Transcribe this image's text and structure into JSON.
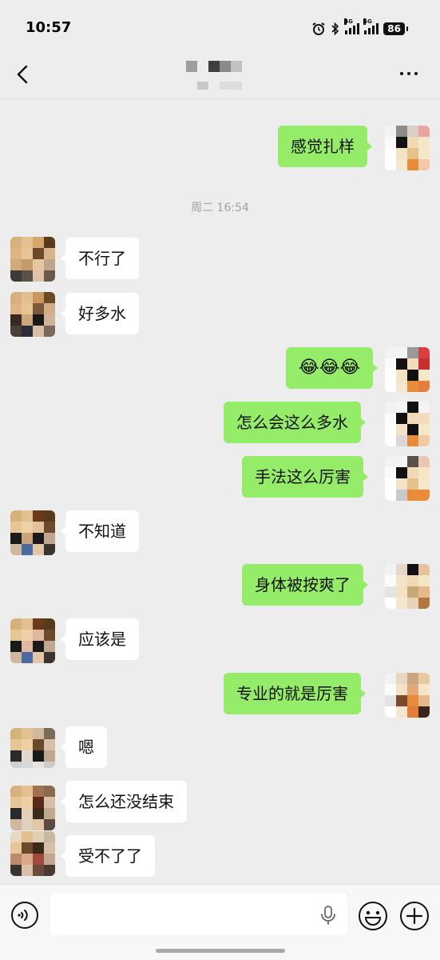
{
  "status_bar": {
    "time": "10:57",
    "net1": "4G",
    "net2": "5G",
    "battery": "86"
  },
  "header": {
    "back_icon": "chevron-left-icon",
    "more_icon": "ellipsis-icon"
  },
  "chat": {
    "messages": [
      {
        "side": "right",
        "text": "感觉扎样"
      },
      {
        "type": "time",
        "text": "周二 16:54"
      },
      {
        "side": "left",
        "text": "不行了"
      },
      {
        "side": "left",
        "text": "好多水"
      },
      {
        "side": "right",
        "text": "😂😂😂"
      },
      {
        "side": "right",
        "text": "怎么会这么多水"
      },
      {
        "side": "right",
        "text": "手法这么厉害"
      },
      {
        "side": "left",
        "text": "不知道"
      },
      {
        "side": "right",
        "text": "身体被按爽了"
      },
      {
        "side": "left",
        "text": "应该是"
      },
      {
        "side": "right",
        "text": "专业的就是厉害"
      },
      {
        "side": "left",
        "text": "嗯"
      },
      {
        "side": "left",
        "text": "怎么还没结束"
      },
      {
        "side": "left",
        "text": "受不了了"
      }
    ]
  },
  "input_bar": {
    "value": "",
    "voice_icon": "voice-icon",
    "mic_icon": "microphone-icon",
    "emoji_icon": "emoji-icon",
    "plus_icon": "plus-icon"
  },
  "colors": {
    "background": "#ededed",
    "bubble_self": "#95ec69",
    "bubble_other": "#ffffff"
  }
}
